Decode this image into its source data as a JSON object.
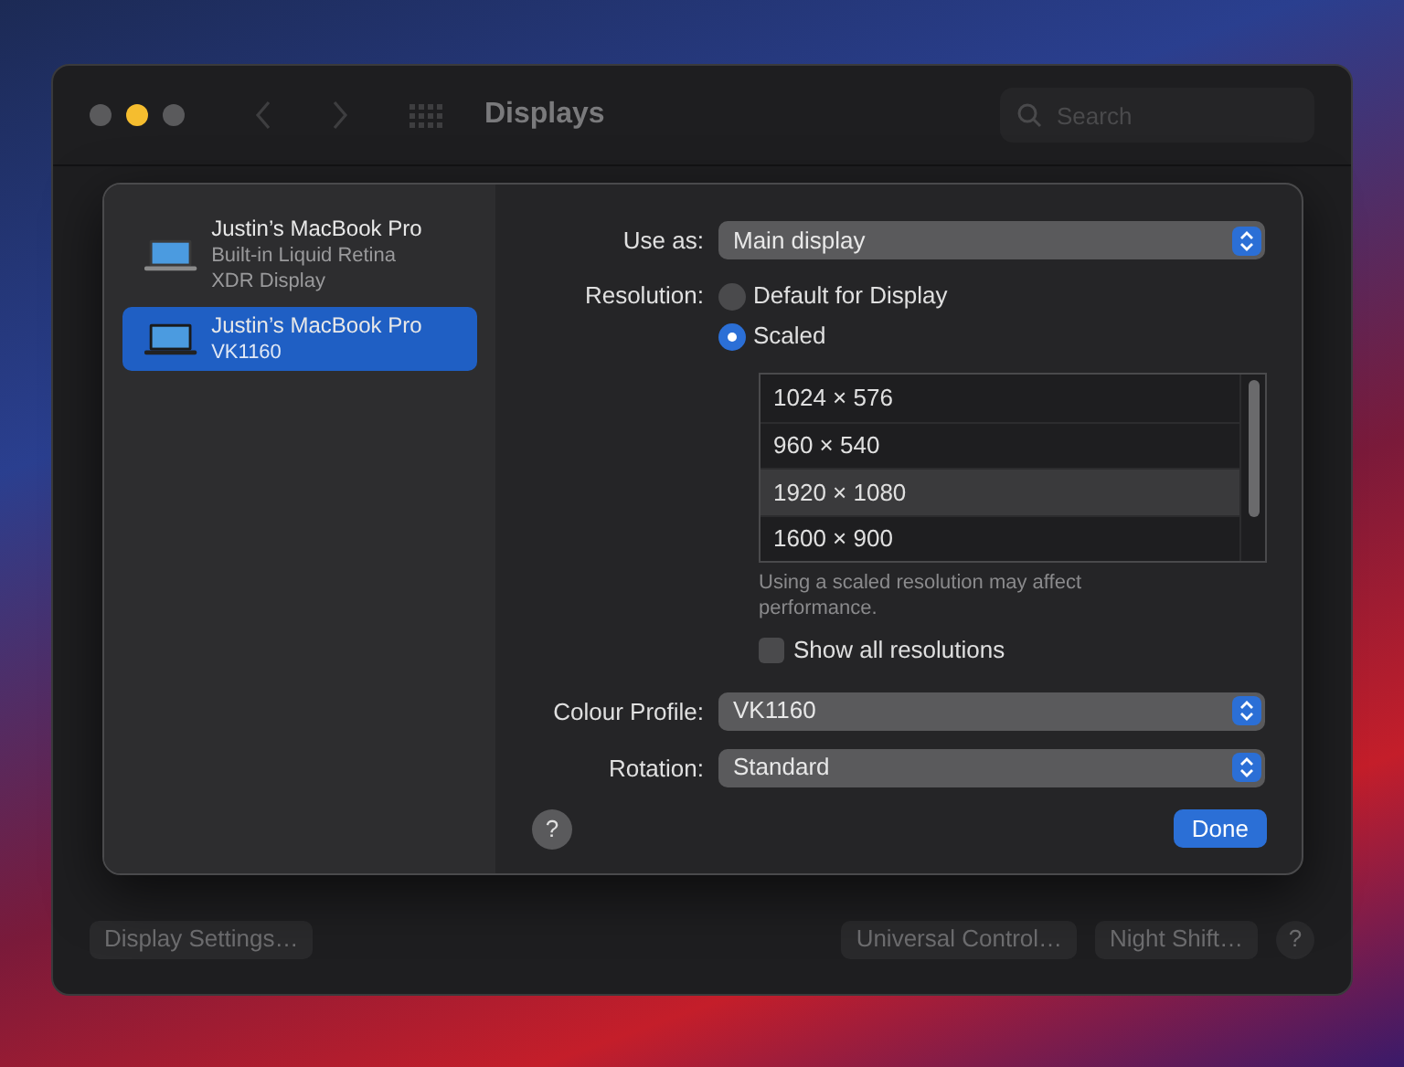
{
  "window": {
    "title": "Displays",
    "search": {
      "placeholder": "Search"
    }
  },
  "sheet": {
    "displays": [
      {
        "name": "Justin’s MacBook Pro",
        "detail": "Built-in Liquid Retina XDR Display",
        "selected": false
      },
      {
        "name": "Justin’s MacBook Pro",
        "detail": "VK1160",
        "selected": true
      }
    ],
    "use_as": {
      "label": "Use as:",
      "value": "Main display"
    },
    "resolution": {
      "label": "Resolution:",
      "options": [
        {
          "label": "Default for Display",
          "selected": false
        },
        {
          "label": "Scaled",
          "selected": true
        }
      ],
      "list": [
        {
          "label": "1024 × 576",
          "selected": false
        },
        {
          "label": "960 × 540",
          "selected": false
        },
        {
          "label": "1920 × 1080",
          "selected": true
        },
        {
          "label": "1600 × 900",
          "selected": false
        }
      ],
      "note": "Using a scaled resolution may affect performance.",
      "show_all": {
        "label": "Show all resolutions",
        "checked": false
      }
    },
    "colour_profile": {
      "label": "Colour Profile:",
      "value": "VK1160"
    },
    "rotation": {
      "label": "Rotation:",
      "value": "Standard"
    },
    "help": "?",
    "done": "Done"
  },
  "footer": {
    "buttons": [
      "Display Settings…",
      "Universal Control…",
      "Night Shift…"
    ],
    "help": "?"
  }
}
